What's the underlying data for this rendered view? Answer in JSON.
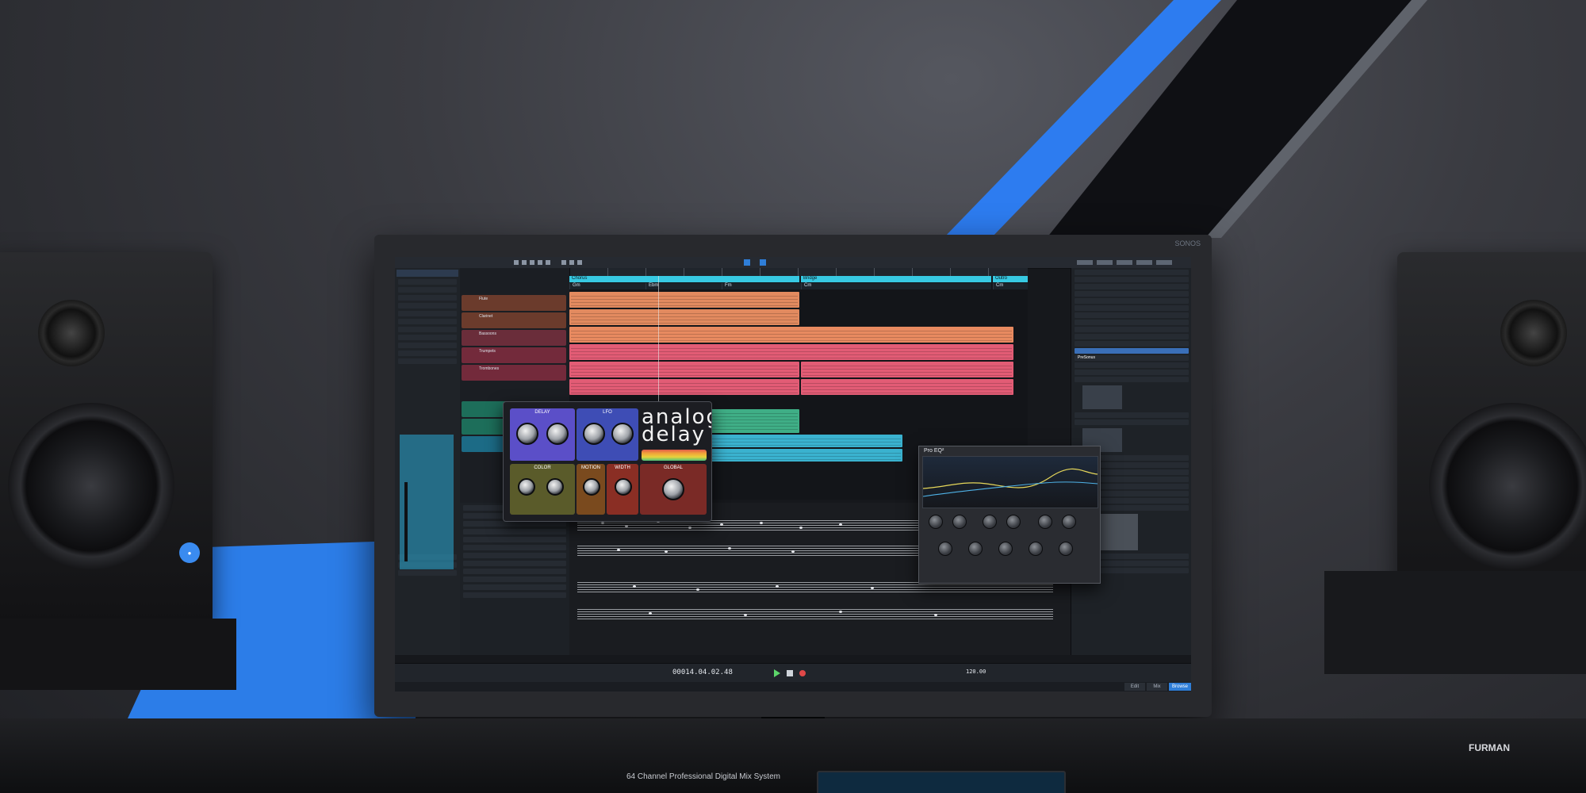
{
  "monitor": {
    "brand": "SONOS"
  },
  "daw": {
    "sections": [
      {
        "label": "Chorus"
      },
      {
        "label": "Bridge"
      },
      {
        "label": "Outro"
      }
    ],
    "chords": [
      "Gm",
      "Ebm",
      "Fm",
      "Cm",
      "Cm"
    ],
    "tracks": [
      {
        "name": "Flute",
        "color": "#c56d46"
      },
      {
        "name": "Clarinet",
        "color": "#c56d46"
      },
      {
        "name": "Bassoons",
        "color": "#b04b5a"
      },
      {
        "name": "Trumpets",
        "color": "#c94a62"
      },
      {
        "name": "Trombones",
        "color": "#c94a62"
      }
    ],
    "transport": {
      "timecode": "00014.04.02.48",
      "tempo": "120.00"
    },
    "view_buttons": [
      {
        "label": "Edit",
        "active": false
      },
      {
        "label": "Mix",
        "active": false
      },
      {
        "label": "Browse",
        "active": true
      }
    ],
    "browser_selected": "PreSonus"
  },
  "plugin": {
    "sections": [
      "DELAY",
      "LFO",
      "COLOR",
      "MOTION",
      "WIDTH",
      "GLOBAL"
    ],
    "logo": "analog delay"
  },
  "eq": {
    "title": "Pro EQ²"
  },
  "console": {
    "label": "64 Channel Professional Digital Mix System",
    "rack_brand": "FURMAN"
  },
  "colors": {
    "accent": "#2f7ed8",
    "section": "#37c9e2"
  }
}
